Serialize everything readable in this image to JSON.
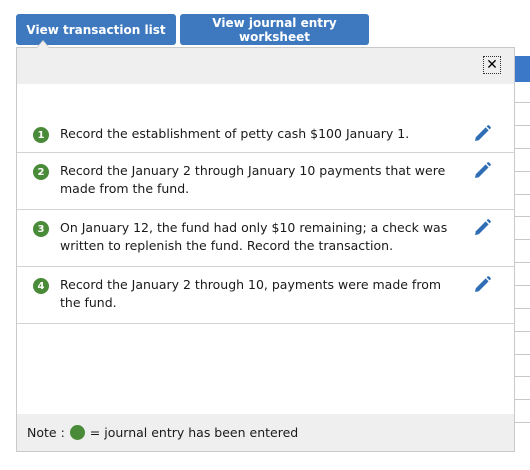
{
  "toolbar": {
    "transaction_list_label": "View transaction list",
    "journal_worksheet_label": "View journal entry worksheet"
  },
  "dialog": {
    "close_label": "✕",
    "items": [
      {
        "number": "1",
        "text": "Record the establishment of petty cash $100 January 1."
      },
      {
        "number": "2",
        "text": "Record the January 2 through January 10 payments that were made from the fund."
      },
      {
        "number": "3",
        "text": "On January 12, the fund had only $10 remaining; a check was written to replenish the fund. Record the transaction."
      },
      {
        "number": "4",
        "text": "Record the January 2 through 10, payments were made from the fund."
      }
    ],
    "note_label": "Note :",
    "note_text": "= journal entry has been entered"
  },
  "colors": {
    "button_blue": "#3e79bf",
    "complete_green": "#4a8b39",
    "pencil_blue": "#2f6db5"
  },
  "icons": {
    "edit": "pencil-icon",
    "close": "close-icon",
    "status": "green-dot-icon"
  }
}
